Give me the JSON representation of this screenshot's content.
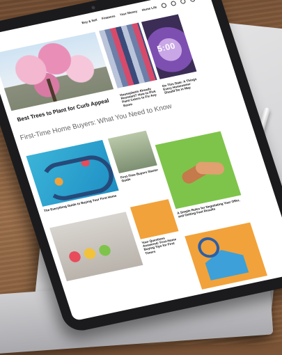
{
  "site": {
    "logo_text": "",
    "nav": [
      "Buy & Sell",
      "Finances",
      "Your Money",
      "Home Life"
    ]
  },
  "articles": [
    {
      "tag": "",
      "title": "Best Trees to Plant for Curb Appeal",
      "sub": ""
    },
    {
      "tag": "",
      "title": "Houseplants Already Resistant? How to Pick Paint Colors to Fix Any Room",
      "sub": ""
    },
    {
      "tag": "",
      "title": "On This Date: A Things Every Homeowner Should Do in May",
      "sub": ""
    },
    {
      "tag": "",
      "title": "First-Time Buyers Starter Guide",
      "sub": ""
    },
    {
      "tag": "",
      "title": "The Everything Guide to Buying Your First Home",
      "sub": ""
    },
    {
      "tag": "",
      "title": "A Simple Rules for Negotiating Your Offer, and Getting Fast Results",
      "sub": ""
    },
    {
      "tag": "",
      "title": "Your Questions Answered: First-Home Buying Tips for First Timers",
      "sub": ""
    }
  ],
  "hero_clock": "5:00",
  "section": {
    "title": "First-Time Home Buyers: What You Need to Know",
    "subtitle": ""
  }
}
